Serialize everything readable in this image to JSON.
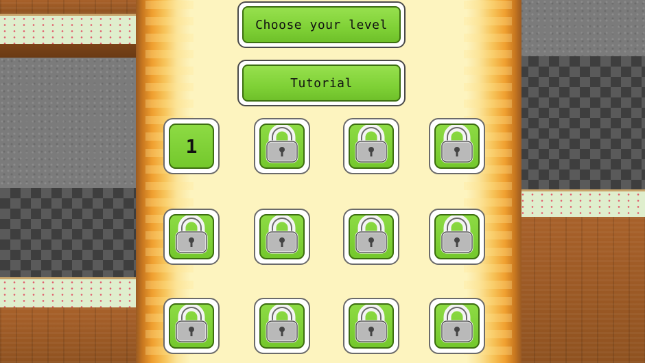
{
  "menu": {
    "choose_label": "Choose your level",
    "tutorial_label": "Tutorial"
  },
  "levels": [
    {
      "label": "1",
      "locked": false
    },
    {
      "label": "",
      "locked": true
    },
    {
      "label": "",
      "locked": true
    },
    {
      "label": "",
      "locked": true
    },
    {
      "label": "",
      "locked": true
    },
    {
      "label": "",
      "locked": true
    },
    {
      "label": "",
      "locked": true
    },
    {
      "label": "",
      "locked": true
    },
    {
      "label": "",
      "locked": true
    },
    {
      "label": "",
      "locked": true
    },
    {
      "label": "",
      "locked": true
    },
    {
      "label": "",
      "locked": true
    }
  ],
  "icons": {
    "locked": "padlock-icon"
  },
  "colors": {
    "button_green": "#7fd136",
    "path_yellow": "#fdf4bf",
    "wood_brown": "#a8612a"
  }
}
